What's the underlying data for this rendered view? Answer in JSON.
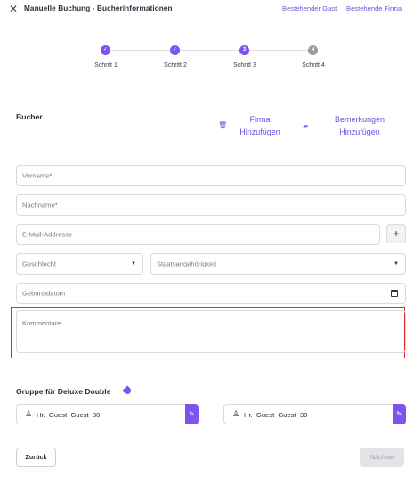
{
  "header": {
    "title": "Manuelle Buchung - Bucherinformationen",
    "links": [
      "Bestehender Gast",
      "Bestehende Firma"
    ]
  },
  "stepper": {
    "steps": [
      {
        "label": "Schritt 1",
        "state": "done",
        "marker": "✓"
      },
      {
        "label": "Schritt 2",
        "state": "done",
        "marker": "✓"
      },
      {
        "label": "Schritt 3",
        "state": "active",
        "marker": "3"
      },
      {
        "label": "Schritt 4",
        "state": "pending",
        "marker": "4"
      }
    ]
  },
  "booker": {
    "title": "Bucher",
    "add_company_line1": "Firma",
    "add_company_line2": "Hinzufügen",
    "add_notes_line1": "Bemerkungen",
    "add_notes_line2": "Hinzufügen"
  },
  "form": {
    "first_name": "Vorname",
    "last_name": "Nachname",
    "required_mark": "*",
    "email": "E-Mail-Addresse",
    "gender": "Geschlecht",
    "nationality": "Staatsangehörigkeit",
    "birth_date": "Geburtsdatum",
    "comments": "Kommentare"
  },
  "group": {
    "title": "Gruppe für Deluxe Double",
    "guests": [
      {
        "text": "Hr.  Guest  Guest  30"
      },
      {
        "text": "Hr.  Guest  Guest  30"
      }
    ]
  },
  "footer": {
    "back": "Zurück",
    "next": "Nächste"
  },
  "colors": {
    "accent": "#7b55ee",
    "link": "#6f4ee6",
    "highlight_border": "#e02a2a"
  }
}
